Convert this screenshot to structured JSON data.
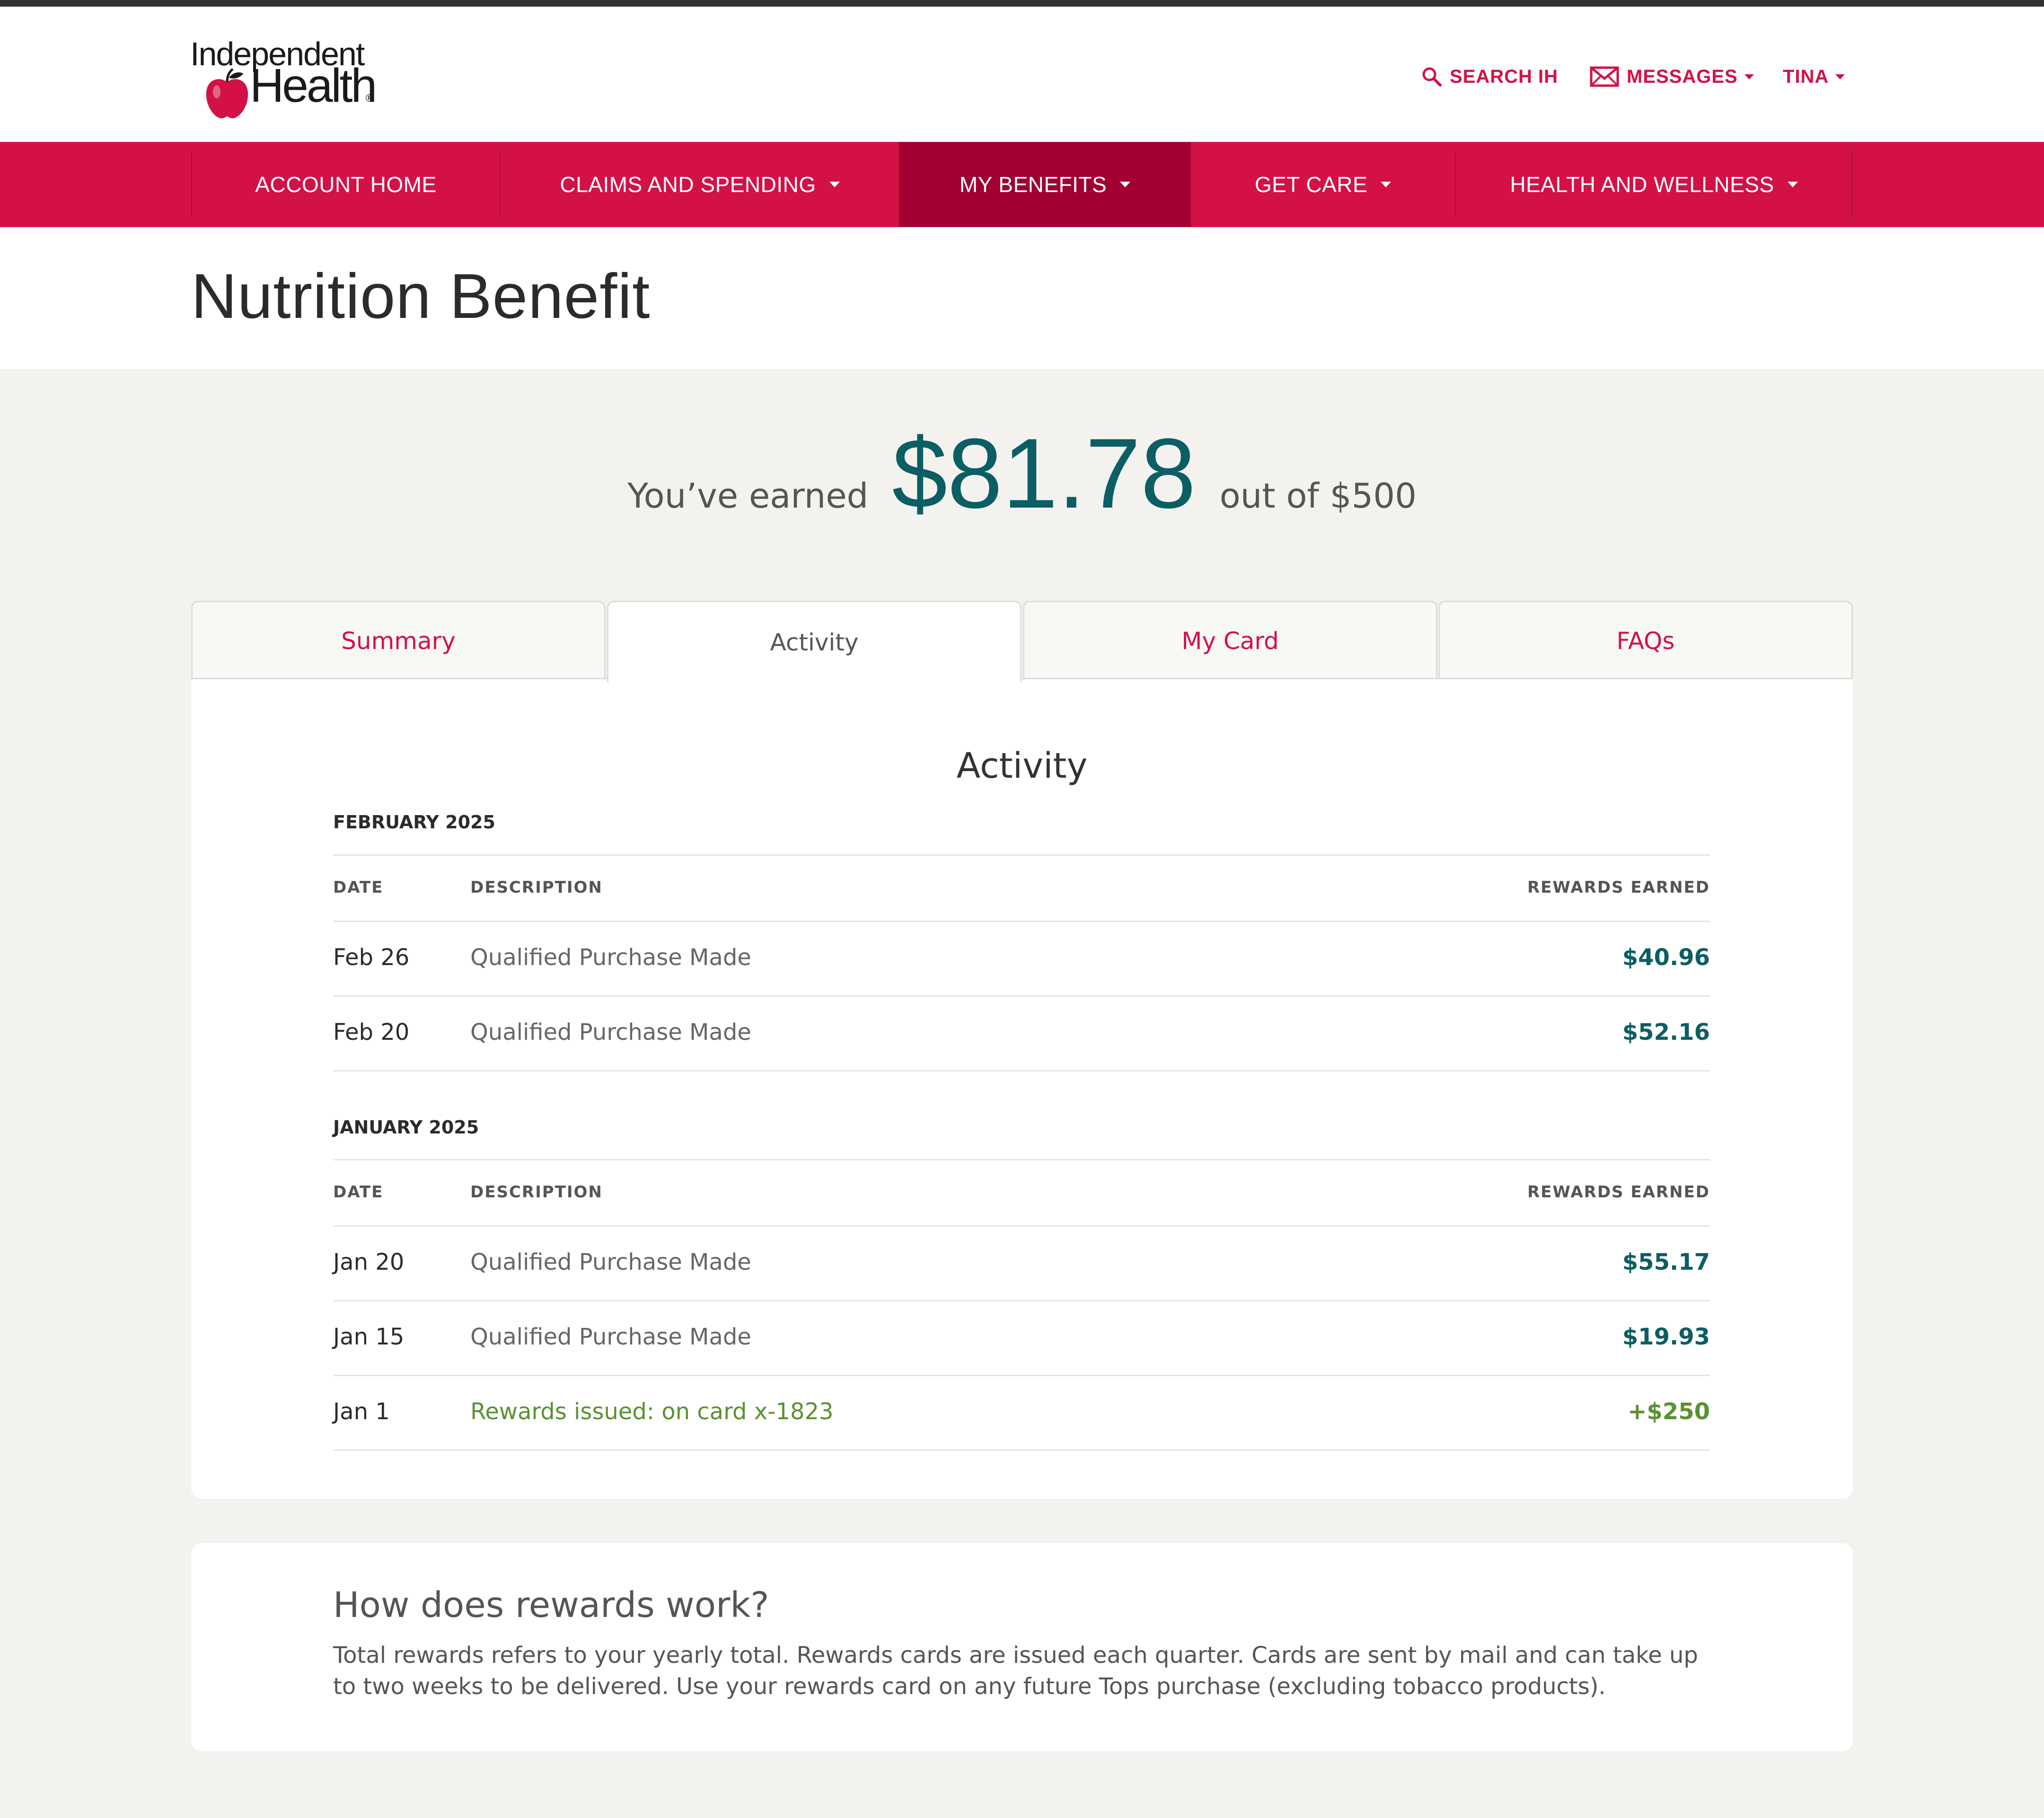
{
  "brand": {
    "line1": "Independent",
    "line2": "Health",
    "reg": "®",
    "colors": {
      "primary": "#d31145",
      "primary_dark": "#a10030",
      "teal": "#0b5e64",
      "green": "#5b9132"
    }
  },
  "utility": {
    "search_label": "SEARCH IH",
    "messages_label": "MESSAGES",
    "user_label": "TINA"
  },
  "nav": {
    "items": [
      {
        "label": "ACCOUNT HOME"
      },
      {
        "label": "CLAIMS AND SPENDING"
      },
      {
        "label": "MY BENEFITS"
      },
      {
        "label": "GET CARE"
      },
      {
        "label": "HEALTH AND WELLNESS"
      }
    ]
  },
  "page": {
    "title": "Nutrition Benefit"
  },
  "earned": {
    "prefix": "You’ve earned",
    "amount": "$81.78",
    "suffix": "out of $500"
  },
  "tabs": [
    {
      "label": "Summary"
    },
    {
      "label": "Activity"
    },
    {
      "label": "My Card"
    },
    {
      "label": "FAQs"
    }
  ],
  "activity": {
    "title": "Activity",
    "columns": {
      "date": "DATE",
      "description": "DESCRIPTION",
      "rewards": "REWARDS EARNED"
    },
    "months": [
      {
        "label": "FEBRUARY 2025",
        "rows": [
          {
            "date": "Feb 26",
            "description": "Qualified Purchase Made",
            "amount": "$40.96"
          },
          {
            "date": "Feb 20",
            "description": "Qualified Purchase Made",
            "amount": "$52.16"
          }
        ]
      },
      {
        "label": "JANUARY 2025",
        "rows": [
          {
            "date": "Jan 20",
            "description": "Qualified Purchase Made",
            "amount": "$55.17"
          },
          {
            "date": "Jan 15",
            "description": "Qualified Purchase Made",
            "amount": "$19.93"
          },
          {
            "date": "Jan 1",
            "description": "Rewards issued: on card x-1823",
            "amount": "+$250"
          }
        ]
      }
    ]
  },
  "how": {
    "title": "How does rewards work?",
    "body": "Total rewards refers to your yearly total. Rewards cards are issued each quarter. Cards are sent by mail and can take up to two weeks to be delivered. Use your rewards card on any future Tops purchase (excluding tobacco products)."
  }
}
